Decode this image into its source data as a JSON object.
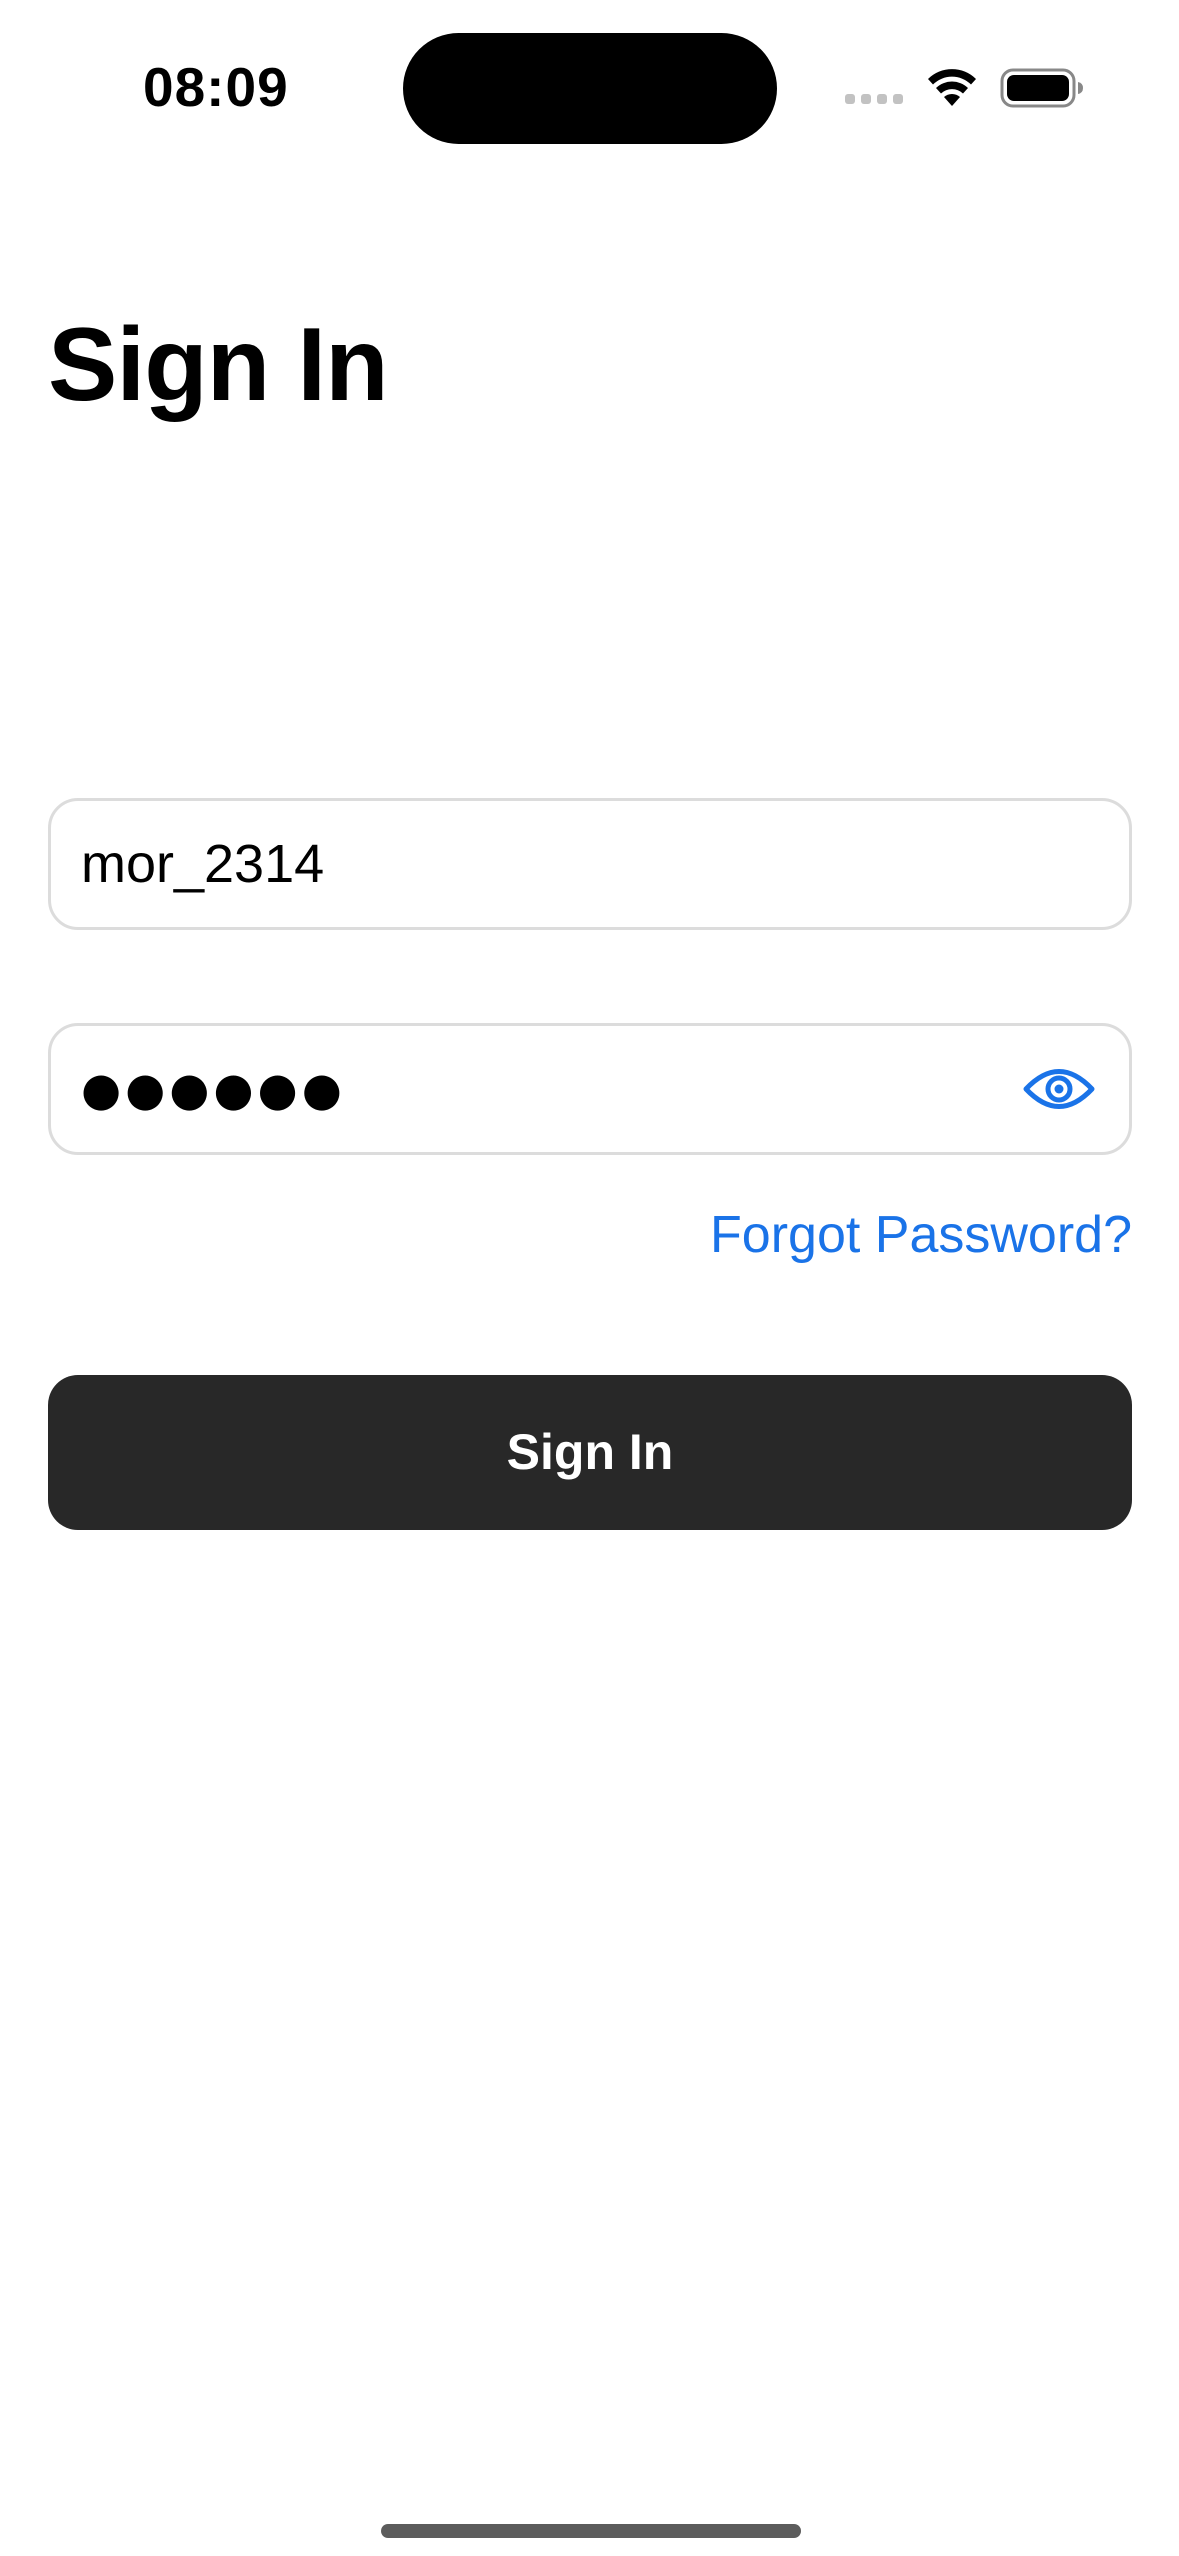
{
  "status_bar": {
    "time": "08:09",
    "icons": [
      "signal-icon",
      "wifi-icon",
      "battery-icon"
    ]
  },
  "page": {
    "title": "Sign In"
  },
  "form": {
    "username": {
      "value": "mor_2314"
    },
    "password": {
      "masked_value": "●●●●●●",
      "toggle_icon": "eye-icon"
    },
    "forgot_password_label": "Forgot Password?",
    "submit_label": "Sign In"
  },
  "colors": {
    "accent": "#1a73e8",
    "button_background": "#282828",
    "field_border": "#dcdcdc",
    "background": "#ffffff"
  }
}
